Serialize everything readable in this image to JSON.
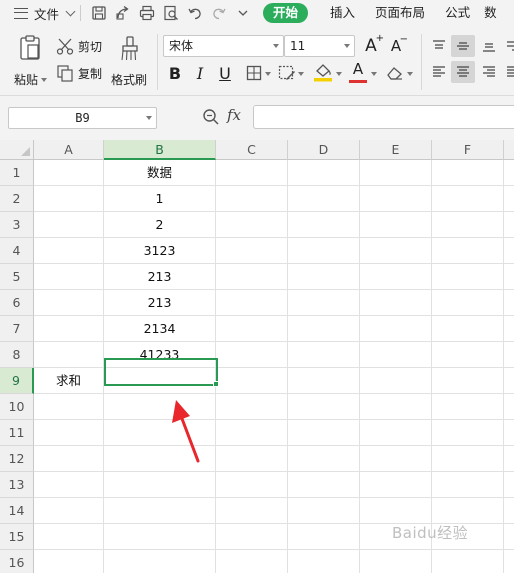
{
  "menubar": {
    "file_label": "文件",
    "tabs": [
      "开始",
      "插入",
      "页面布局",
      "公式",
      "数"
    ],
    "active_tab": "开始"
  },
  "ribbon": {
    "paste_label": "粘贴",
    "cut_label": "剪切",
    "copy_label": "复制",
    "format_painter_label": "格式刷",
    "font_name": "宋体",
    "font_size": "11",
    "grow_font": "A",
    "shrink_font": "A",
    "bold": "B",
    "italic": "I",
    "underline": "U",
    "font_color_letter": "A",
    "accent_color": "#2bad5b",
    "font_color": "#e03131",
    "fill_color": "#f5d000"
  },
  "formula_bar": {
    "cell_reference": "B9",
    "fx_label": "fx",
    "formula_value": ""
  },
  "grid": {
    "columns": [
      "A",
      "B",
      "C",
      "D",
      "E",
      "F"
    ],
    "rows": [
      "1",
      "2",
      "3",
      "4",
      "5",
      "6",
      "7",
      "8",
      "9",
      "10",
      "11",
      "12",
      "13",
      "14",
      "15",
      "16"
    ],
    "active_column": "B",
    "active_row": "9",
    "cells": {
      "B1": "数据",
      "B2": "1",
      "B3": "2",
      "B4": "3123",
      "B5": "213",
      "B6": "213",
      "B7": "2134",
      "B8": "41233",
      "A9": "求和",
      "B9": ""
    },
    "selection_color": "#2a9a52",
    "annotation_arrow_color": "#e8262b"
  },
  "watermark": "Baidu经验"
}
